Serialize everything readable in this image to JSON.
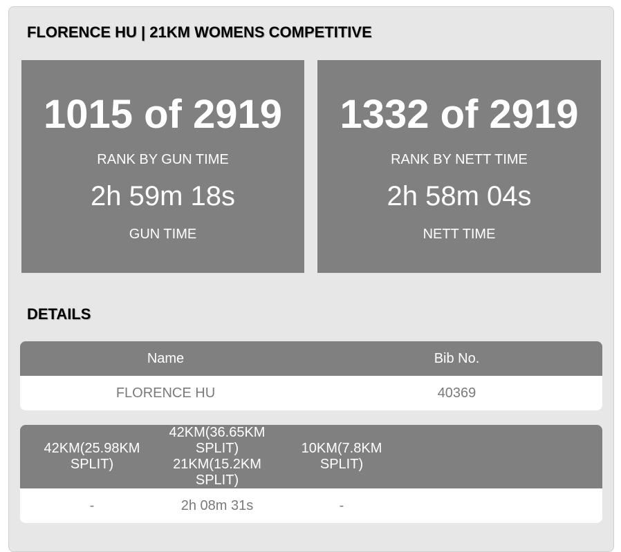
{
  "page": {
    "title": "FLORENCE HU | 21KM WOMENS COMPETITIVE",
    "details_heading": "DETAILS"
  },
  "stats": [
    {
      "rank": "1015 of 2919",
      "rank_label": "RANK BY GUN TIME",
      "time": "2h 59m 18s",
      "time_label": "GUN TIME"
    },
    {
      "rank": "1332 of 2919",
      "rank_label": "RANK BY NETT TIME",
      "time": "2h 58m 04s",
      "time_label": "NETT TIME"
    }
  ],
  "info_table": {
    "headers": [
      "Name",
      "Bib No."
    ],
    "row": [
      "FLORENCE HU",
      "40369"
    ]
  },
  "splits_table": {
    "headers": [
      "42KM(25.98KM SPLIT)",
      "42KM(36.65KM SPLIT)",
      "21KM(15.2KM SPLIT)",
      "10KM(7.8KM SPLIT)"
    ],
    "row": [
      "-",
      "2h 08m 31s",
      "-"
    ]
  },
  "colors": {
    "panel_background": "#e7e7e7",
    "stat_box": "#808080",
    "table_header": "#808080",
    "table_text": "#7a7a7a"
  }
}
